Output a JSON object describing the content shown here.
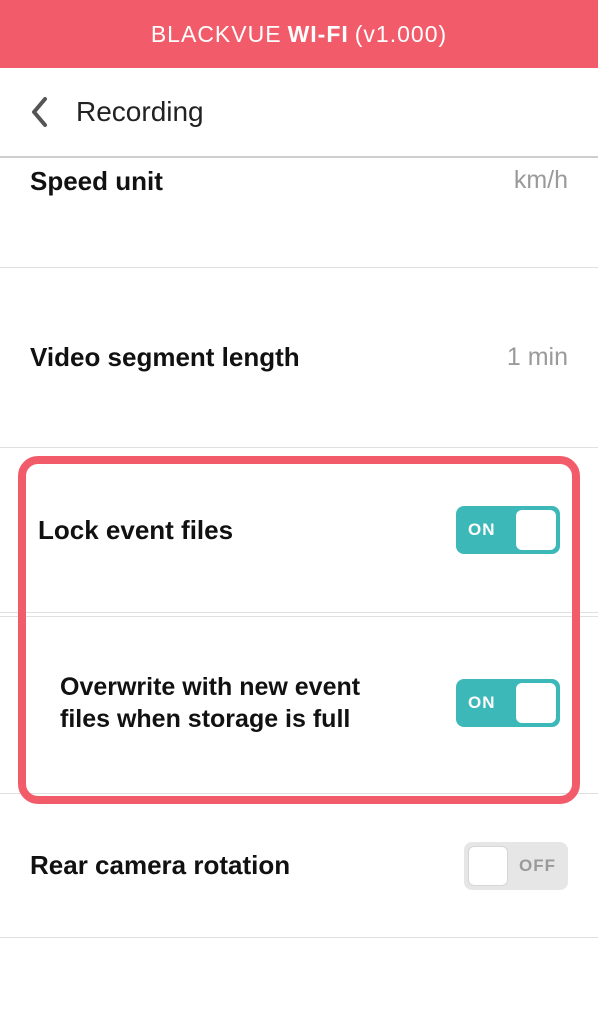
{
  "header": {
    "brand": "BLACKVUE",
    "product": "WI-FI",
    "version": "(v1.000)"
  },
  "nav": {
    "title": "Recording"
  },
  "settings": {
    "speed_unit": {
      "label": "Speed unit",
      "value": "km/h"
    },
    "segment_length": {
      "label": "Video segment length",
      "value": "1 min"
    },
    "lock_event": {
      "label": "Lock event files",
      "state_text": "ON",
      "on": true
    },
    "overwrite": {
      "label": "Overwrite with new event files when storage is full",
      "state_text": "ON",
      "on": true
    },
    "rear_rotation": {
      "label": "Rear camera rotation",
      "state_text": "OFF",
      "on": false
    }
  }
}
